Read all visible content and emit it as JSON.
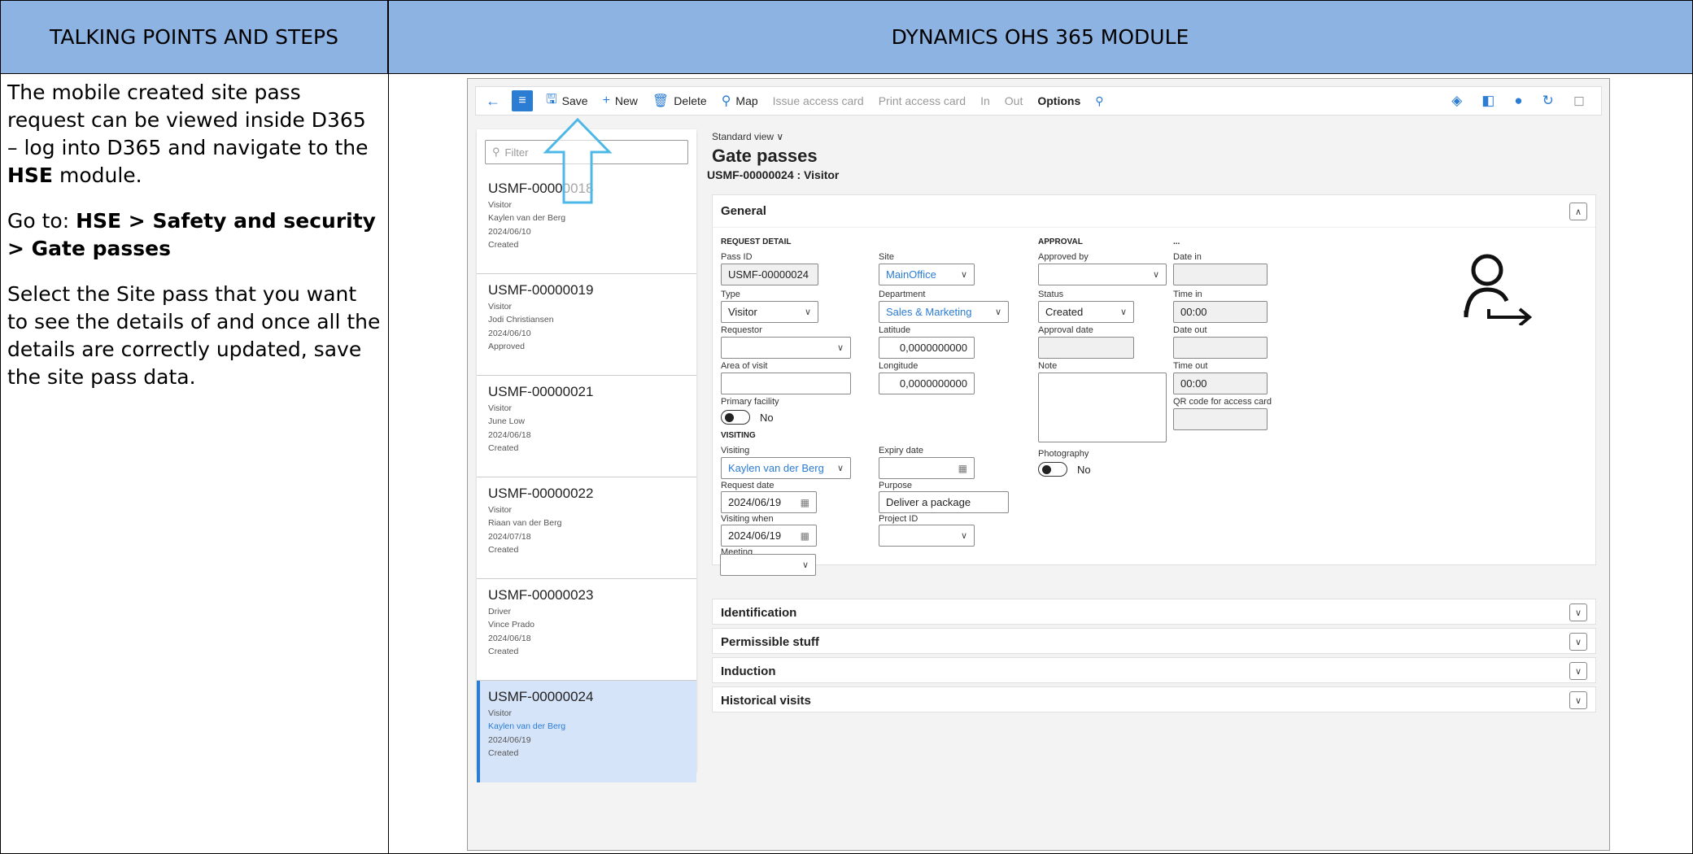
{
  "doc": {
    "left_header": "TALKING POINTS AND STEPS",
    "right_header": "DYNAMICS OHS 365 MODULE",
    "para1_text": "The mobile created site pass request can be viewed inside D365 – log into D365 and navigate to the ",
    "para1_bold": "HSE",
    "para1_end": " module.",
    "para2_lead": "Go to: ",
    "para2_bold": "HSE > Safety and security > Gate passes",
    "para3": "Select the Site pass that you want to see the details of and once all the details are correctly updated, save the site pass data."
  },
  "toolbar": {
    "save": "Save",
    "new": "New",
    "delete": "Delete",
    "map": "Map",
    "issue": "Issue access card",
    "print": "Print access card",
    "in": "In",
    "out": "Out",
    "options": "Options"
  },
  "list": {
    "filter_placeholder": "Filter",
    "items": [
      {
        "id": "USMF-00000018",
        "type": "Visitor",
        "name": "Kaylen van der Berg",
        "date": "2024/06/10",
        "status": "Created"
      },
      {
        "id": "USMF-00000019",
        "type": "Visitor",
        "name": "Jodi Christiansen",
        "date": "2024/06/10",
        "status": "Approved"
      },
      {
        "id": "USMF-00000021",
        "type": "Visitor",
        "name": "June Low",
        "date": "2024/06/18",
        "status": "Created"
      },
      {
        "id": "USMF-00000022",
        "type": "Visitor",
        "name": "Riaan van der Berg",
        "date": "2024/07/18",
        "status": "Created"
      },
      {
        "id": "USMF-00000023",
        "type": "Driver",
        "name": "Vince Prado",
        "date": "2024/06/18",
        "status": "Created"
      },
      {
        "id": "USMF-00000024",
        "type": "Visitor",
        "name": "Kaylen van der Berg",
        "date": "2024/06/19",
        "status": "Created"
      }
    ]
  },
  "main": {
    "view": "Standard view",
    "title": "Gate passes",
    "subtitle": "USMF-00000024 : Visitor",
    "general": "General",
    "request_detail": "REQUEST DETAIL",
    "approval": "APPROVAL",
    "ellipsis": "...",
    "visiting_section": "VISITING",
    "labels": {
      "pass_id": "Pass ID",
      "site": "Site",
      "approved_by": "Approved by",
      "date_in": "Date in",
      "type": "Type",
      "department": "Department",
      "status": "Status",
      "time_in": "Time in",
      "requestor": "Requestor",
      "latitude": "Latitude",
      "approval_date": "Approval date",
      "date_out": "Date out",
      "area": "Area of visit",
      "longitude": "Longitude",
      "note": "Note",
      "time_out": "Time out",
      "qr": "QR code for access card",
      "primary": "Primary facility",
      "visiting": "Visiting",
      "expiry": "Expiry date",
      "photography": "Photography",
      "request_date": "Request date",
      "purpose": "Purpose",
      "visiting_when": "Visiting when",
      "project": "Project ID",
      "meeting": "Meeting"
    },
    "values": {
      "pass_id": "USMF-00000024",
      "site": "MainOffice",
      "type": "Visitor",
      "department": "Sales & Marketing",
      "status": "Created",
      "time_in": "00:00",
      "latitude": "0,0000000000",
      "longitude": "0,0000000000",
      "time_out": "00:00",
      "primary": "No",
      "visiting": "Kaylen van der Berg",
      "photography": "No",
      "request_date": "2024/06/19",
      "purpose": "Deliver a package",
      "visiting_when": "2024/06/19"
    },
    "sections": [
      "Identification",
      "Permissible stuff",
      "Induction",
      "Historical visits"
    ]
  }
}
